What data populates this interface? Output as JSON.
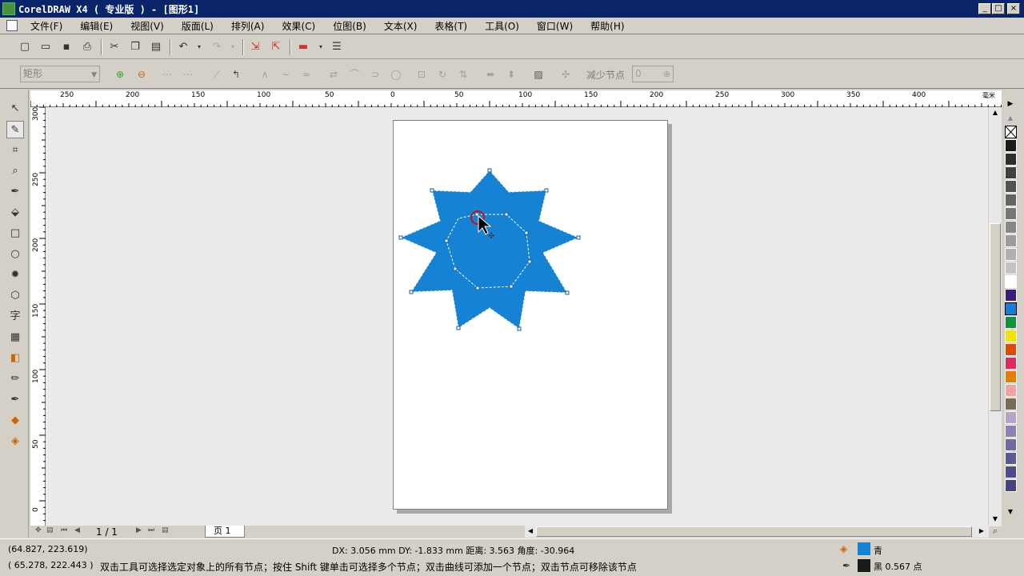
{
  "window": {
    "title": "CorelDRAW X4 ( 专业版 ) - [图形1]",
    "buttons": [
      "_",
      "□",
      "×"
    ]
  },
  "menu": {
    "items": [
      "文件(F)",
      "编辑(E)",
      "视图(V)",
      "版面(L)",
      "排列(A)",
      "效果(C)",
      "位图(B)",
      "文本(X)",
      "表格(T)",
      "工具(O)",
      "窗口(W)",
      "帮助(H)"
    ]
  },
  "property_bar": {
    "shape_type": "矩形",
    "reduce_nodes_label": "减少节点",
    "reduce_nodes_value": "0"
  },
  "rulers": {
    "h_labels": [
      "250",
      "200",
      "150",
      "100",
      "50",
      "0",
      "50",
      "100",
      "150",
      "200",
      "250",
      "300",
      "350",
      "400"
    ],
    "unit": "毫米",
    "v_labels": [
      "300",
      "250",
      "200",
      "150",
      "100",
      "50",
      "0"
    ]
  },
  "page_navigator": {
    "count": "1 / 1",
    "tab": "页 1"
  },
  "palette": {
    "colors": [
      "#1b1b1b",
      "#2e2e2e",
      "#3f3f3f",
      "#525252",
      "#636363",
      "#767676",
      "#898989",
      "#9c9c9c",
      "#b0b0b0",
      "#c4c4c4",
      "#ffffff",
      "#3b1e78",
      "#1382d6",
      "#13923b",
      "#f2e400",
      "#e04a00",
      "#e3285f",
      "#e87c00",
      "#f4a3a0",
      "#786c54",
      "#b7a5c9",
      "#8c80b8",
      "#6e6aa8",
      "#5c5896",
      "#4e4c88",
      "#46447c"
    ]
  },
  "status": {
    "cursor_pos": "(64.827, 223.619)",
    "delta": "DX: 3.056 mm DY: -1.833 mm 距离: 3.563 角度: -30.964",
    "node_pos": "( 65.278, 222.443 )",
    "hint": "双击工具可选择选定对象上的所有节点；按住 Shift 键单击可选择多个节点；双击曲线可添加一个节点；双击节点可移除该节点",
    "fill_label": "青",
    "fill_color": "#1382d6",
    "outline_label": "黑 0.567 点",
    "outline_color": "#1b1b1b"
  },
  "shape": {
    "fill": "#1582d4"
  }
}
